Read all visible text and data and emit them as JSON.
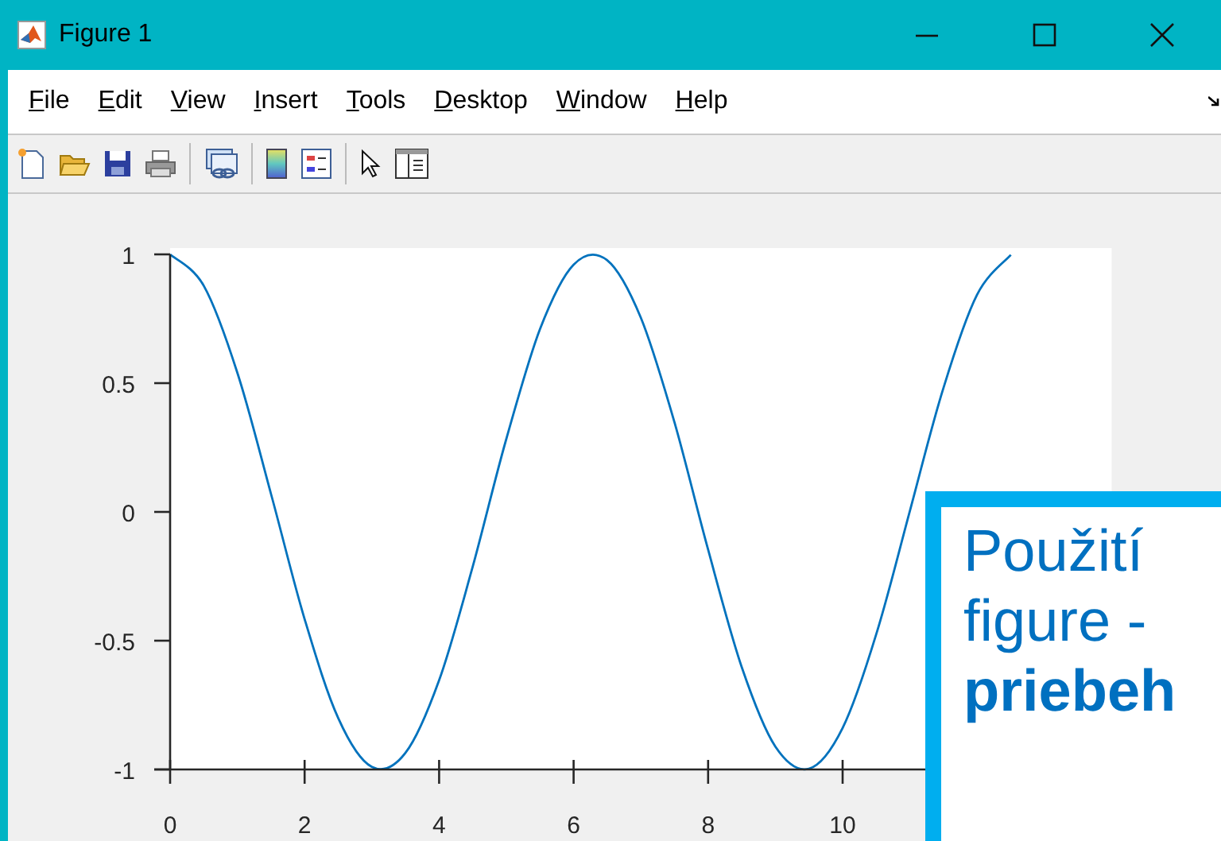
{
  "window": {
    "title": "Figure 1"
  },
  "menu": [
    "File",
    "Edit",
    "View",
    "Insert",
    "Tools",
    "Desktop",
    "Window",
    "Help"
  ],
  "figure": {
    "chart_data": {
      "type": "line",
      "xlim": [
        0,
        14
      ],
      "ylim": [
        -1,
        1
      ],
      "xticks": [
        0,
        2,
        4,
        6,
        8,
        10
      ],
      "yticks": [
        -1,
        -0.5,
        0,
        0.5,
        1
      ],
      "x": [
        0,
        0.5,
        1,
        1.5,
        2,
        2.5,
        3,
        3.5,
        4,
        4.5,
        5,
        5.5,
        6,
        6.5,
        7,
        7.5,
        8,
        8.5,
        9,
        9.5,
        10,
        10.5,
        11,
        11.5,
        12,
        12.5
      ],
      "series": [
        {
          "color": "#0072bd",
          "values": [
            1,
            0.878,
            0.54,
            0.071,
            -0.416,
            -0.801,
            -0.99,
            -0.936,
            -0.654,
            -0.211,
            0.284,
            0.709,
            0.96,
            0.977,
            0.754,
            0.347,
            -0.146,
            -0.602,
            -0.911,
            -0.997,
            -0.839,
            -0.476,
            0.004,
            0.483,
            0.844,
            0.998
          ]
        }
      ]
    }
  },
  "callout": {
    "text": "Použití figure - **priebeh**"
  }
}
